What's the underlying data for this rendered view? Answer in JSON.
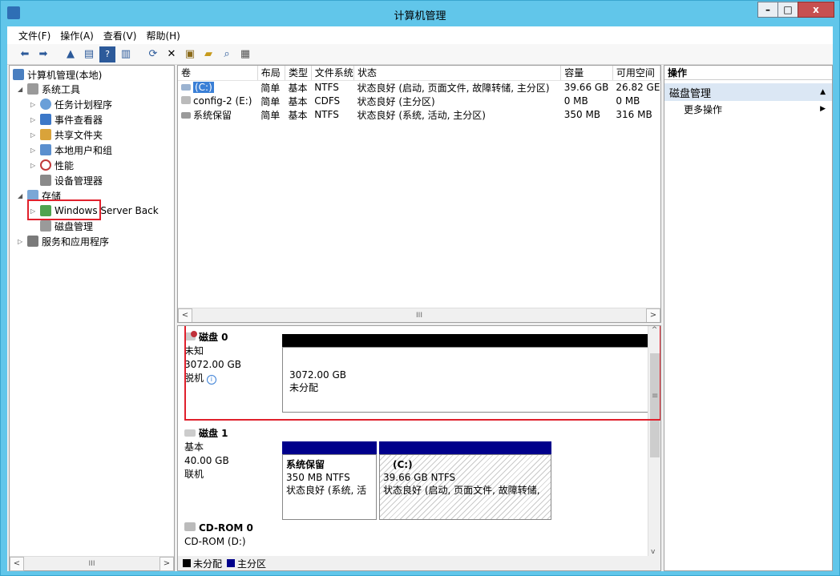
{
  "window": {
    "title": "计算机管理",
    "min": "–",
    "max": "□",
    "close": "x"
  },
  "menu": [
    "文件(F)",
    "操作(A)",
    "查看(V)",
    "帮助(H)"
  ],
  "tree": {
    "root": "计算机管理(本地)",
    "system_tools": "系统工具",
    "task_scheduler": "任务计划程序",
    "event_viewer": "事件查看器",
    "shared_folders": "共享文件夹",
    "local_users": "本地用户和组",
    "performance": "性能",
    "device_manager": "设备管理器",
    "storage": "存储",
    "wsb": "Windows Server Back",
    "disk_mgmt": "磁盘管理",
    "services": "服务和应用程序"
  },
  "volume_list": {
    "headers": [
      "卷",
      "布局",
      "类型",
      "文件系统",
      "状态",
      "容量",
      "可用空间"
    ],
    "rows": [
      [
        "(C:)",
        "简单",
        "基本",
        "NTFS",
        "状态良好 (启动, 页面文件, 故障转储, 主分区)",
        "39.66 GB",
        "26.82 GE"
      ],
      [
        "config-2 (E:)",
        "简单",
        "基本",
        "CDFS",
        "状态良好 (主分区)",
        "0 MB",
        "0 MB"
      ],
      [
        "系统保留",
        "简单",
        "基本",
        "NTFS",
        "状态良好 (系统, 活动, 主分区)",
        "350 MB",
        "316 MB"
      ]
    ]
  },
  "actions": {
    "header": "操作",
    "section": "磁盘管理",
    "more": "更多操作"
  },
  "disks": {
    "disk0": {
      "name": "磁盘 0",
      "type": "未知",
      "size": "3072.00 GB",
      "status": "脱机",
      "part_size": "3072.00 GB",
      "part_state": "未分配"
    },
    "disk1": {
      "name": "磁盘 1",
      "type": "基本",
      "size": "40.00 GB",
      "status": "联机",
      "p1_title": "系统保留",
      "p1_fs": "350 MB NTFS",
      "p1_state": "状态良好 (系统, 活",
      "p2_title": "(C:)",
      "p2_fs": "39.66 GB NTFS",
      "p2_state": "状态良好 (启动, 页面文件, 故障转储,"
    },
    "cdrom": {
      "name": "CD-ROM 0",
      "label": "CD-ROM (D:)"
    }
  },
  "legend": {
    "unallocated": "未分配",
    "primary": "主分区"
  },
  "colors": {
    "titlebar": "#61c6ea",
    "primary": "#00008b",
    "highlight": "#e0202c"
  }
}
